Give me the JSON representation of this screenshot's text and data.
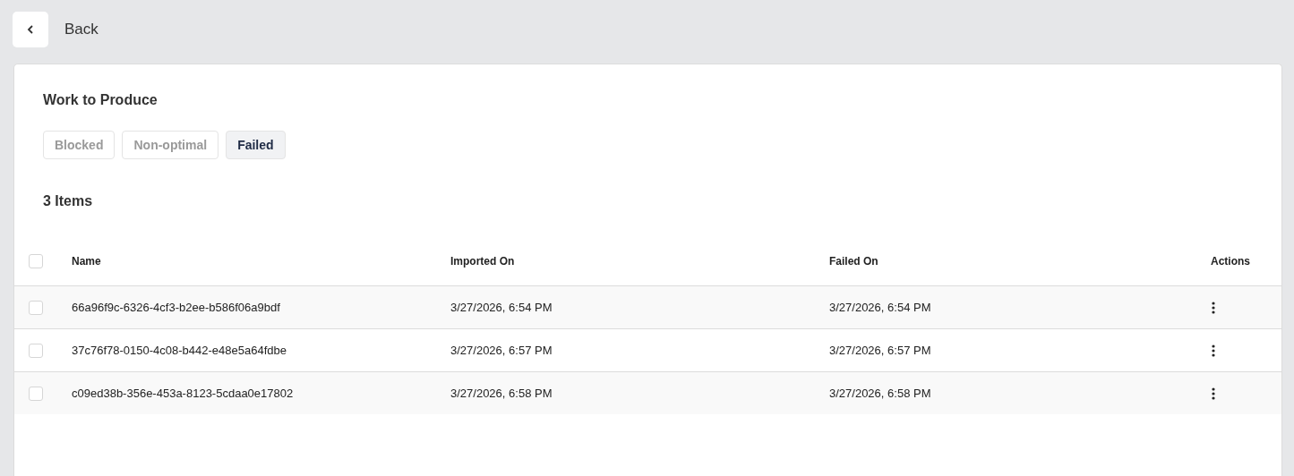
{
  "back": {
    "label": "Back"
  },
  "title": "Work to Produce",
  "tabs": [
    {
      "label": "Blocked",
      "selected": false
    },
    {
      "label": "Non-optimal",
      "selected": false
    },
    {
      "label": "Failed",
      "selected": true
    }
  ],
  "count": "3 Items",
  "table": {
    "select_all": {
      "checked": false
    },
    "columns": [
      "Name",
      "Imported On",
      "Failed On",
      "Actions"
    ],
    "rows": [
      {
        "checked": false,
        "name": "66a96f9c-6326-4cf3-b2ee-b586f06a9bdf",
        "imported_on": "3/27/2026, 6:54 PM",
        "failed_on": "3/27/2026, 6:54 PM"
      },
      {
        "checked": false,
        "name": "37c76f78-0150-4c08-b442-e48e5a64fdbe",
        "imported_on": "3/27/2026, 6:57 PM",
        "failed_on": "3/27/2026, 6:57 PM"
      },
      {
        "checked": false,
        "name": "c09ed38b-356e-453a-8123-5cdaa0e17802",
        "imported_on": "3/27/2026, 6:58 PM",
        "failed_on": "3/27/2026, 6:58 PM"
      }
    ]
  }
}
